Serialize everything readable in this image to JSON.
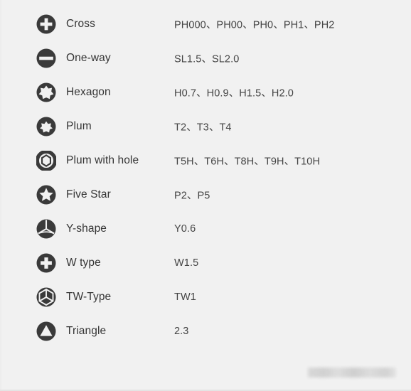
{
  "page": {
    "background_color": "#f1f1f1",
    "icon_color": "#3a3a3a",
    "name_text_color": "#353535",
    "sizes_text_color": "#444444"
  },
  "bits": [
    {
      "icon": "cross-phillips-icon",
      "name": "Cross",
      "sizes": "PH000、PH00、PH0、PH1、PH2"
    },
    {
      "icon": "one-way-slotted-icon",
      "name": "One-way",
      "sizes": "SL1.5、SL2.0"
    },
    {
      "icon": "hexagon-star-icon",
      "name": "Hexagon",
      "sizes": "H0.7、H0.9、H1.5、H2.0"
    },
    {
      "icon": "plum-torx-icon",
      "name": "Plum",
      "sizes": "T2、T3、T4"
    },
    {
      "icon": "plum-with-hole-icon",
      "name": "Plum with hole",
      "sizes": "T5H、T6H、T8H、T9H、T10H"
    },
    {
      "icon": "five-star-pentalobe-icon",
      "name": "Five Star",
      "sizes": "P2、P5"
    },
    {
      "icon": "y-shape-tripoint-icon",
      "name": "Y-shape",
      "sizes": "Y0.6"
    },
    {
      "icon": "w-type-cross-icon",
      "name": "W type",
      "sizes": "W1.5"
    },
    {
      "icon": "tw-type-hexagon-icon",
      "name": "TW-Type",
      "sizes": "TW1"
    },
    {
      "icon": "triangle-icon",
      "name": "Triangle",
      "sizes": "2.3"
    }
  ],
  "watermark": {
    "label": "blurred-watermark"
  }
}
